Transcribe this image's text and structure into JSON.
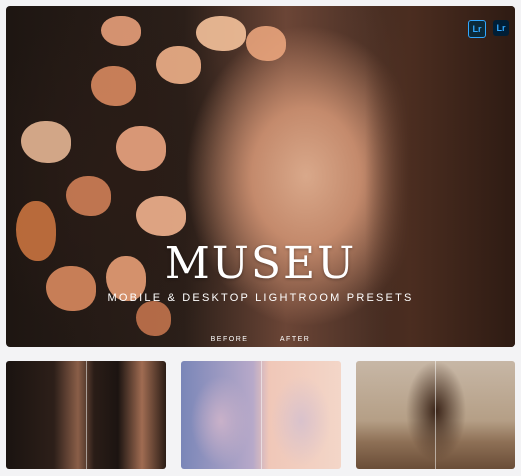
{
  "hero": {
    "title": "MUSEU",
    "subtitle": "MOBILE & DESKTOP LIGHTROOM PRESETS",
    "before_label": "BEFORE",
    "after_label": "AFTER",
    "badges": [
      "Lr",
      "Lr"
    ]
  },
  "colors": {
    "background": "#f3f3f5",
    "text": "#ffffff",
    "badge_accent": "#31a8ff"
  },
  "thumbnails": [
    {
      "name": "portrait-flowers-before-after"
    },
    {
      "name": "portrait-sunglasses-before-after"
    },
    {
      "name": "portrait-windblown-hair"
    }
  ]
}
